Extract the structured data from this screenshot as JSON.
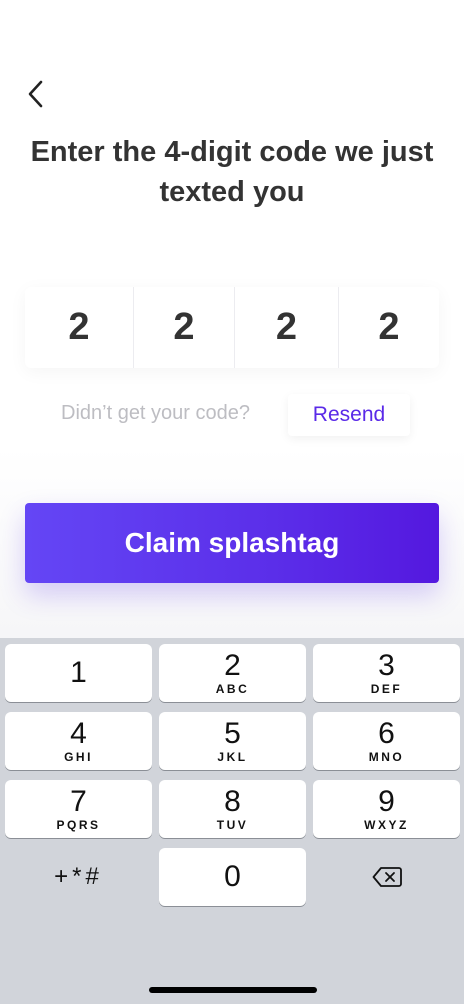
{
  "header": {
    "back_icon": "chevron-left-icon",
    "title": "Enter the 4-digit code we just texted you"
  },
  "code": {
    "digits": [
      "2",
      "2",
      "2",
      "2"
    ]
  },
  "resend": {
    "prompt": "Didn’t get your code?",
    "button_label": "Resend"
  },
  "claim_button_label": "Claim splashtag",
  "colors": {
    "accent": "#5a2ae8",
    "button_gradient_start": "#6446f5",
    "button_gradient_end": "#5418df",
    "keyboard_bg": "#d1d4da"
  },
  "keypad": {
    "keys": [
      {
        "digit": "1",
        "letters": ""
      },
      {
        "digit": "2",
        "letters": "ABC"
      },
      {
        "digit": "3",
        "letters": "DEF"
      },
      {
        "digit": "4",
        "letters": "GHI"
      },
      {
        "digit": "5",
        "letters": "JKL"
      },
      {
        "digit": "6",
        "letters": "MNO"
      },
      {
        "digit": "7",
        "letters": "PQRS"
      },
      {
        "digit": "8",
        "letters": "TUV"
      },
      {
        "digit": "9",
        "letters": "WXYZ"
      },
      {
        "digit": "0",
        "letters": ""
      }
    ],
    "symbols_label": "+*#",
    "delete_icon": "backspace-icon"
  }
}
